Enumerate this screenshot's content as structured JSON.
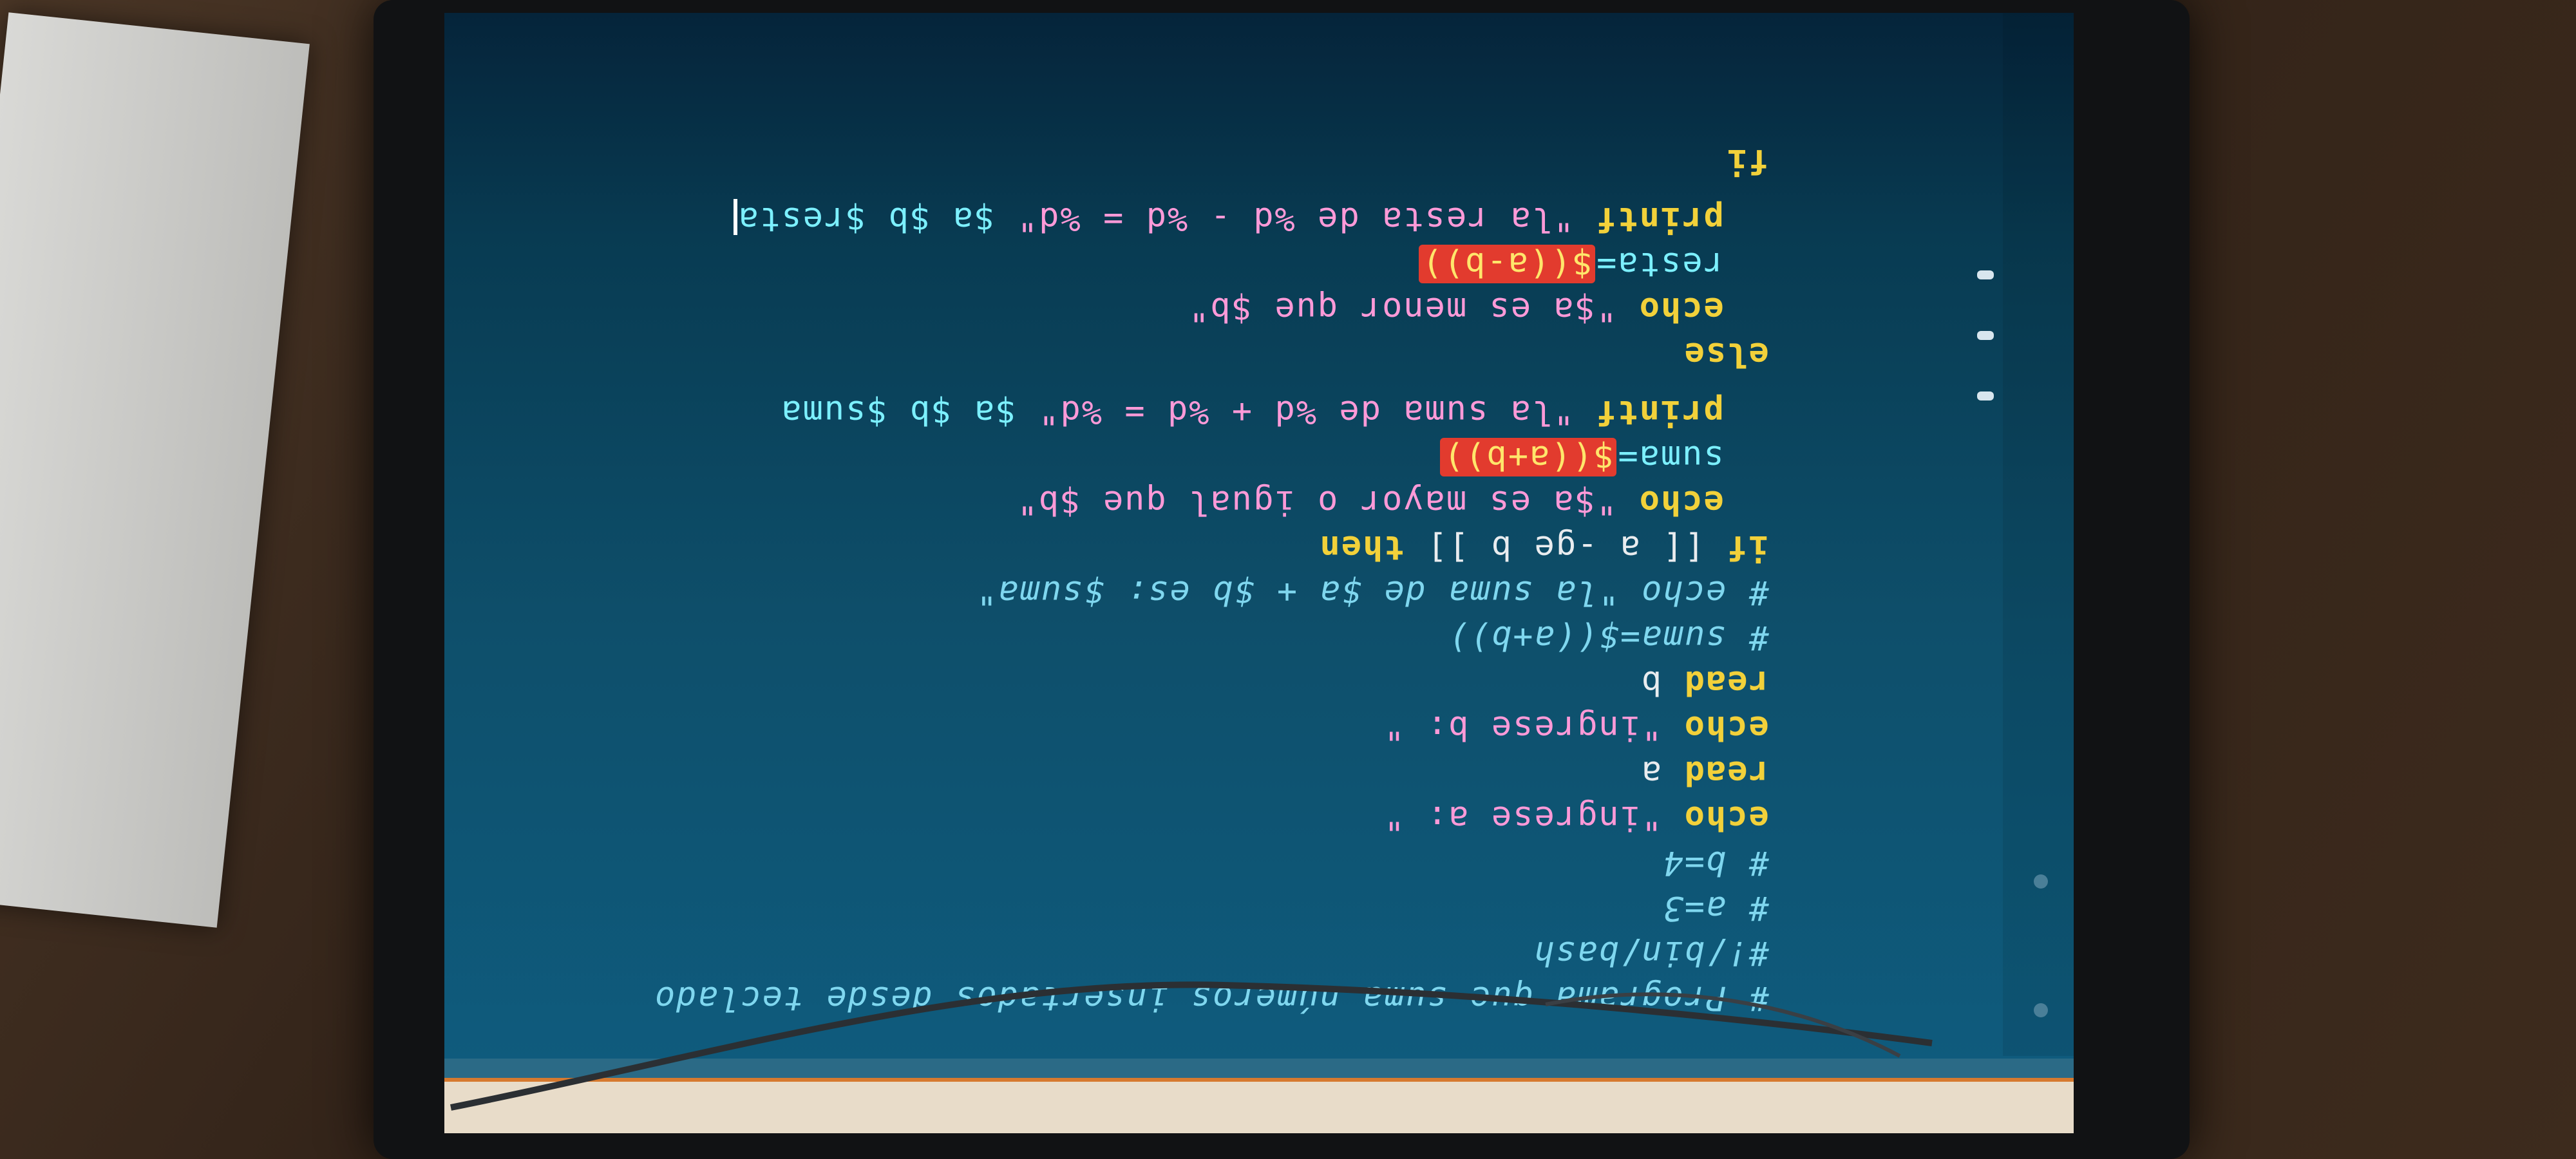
{
  "window": {
    "title": "# Programa que suma números insertados desde teclado"
  },
  "code_lines": [
    {
      "id": "l1",
      "text": "# Programa que suma números insertados desde teclado",
      "kind": "comment"
    },
    {
      "id": "l2",
      "text": "#!/bin/bash",
      "kind": "comment"
    },
    {
      "id": "l3",
      "text": "# a=3",
      "kind": "comment"
    },
    {
      "id": "l4",
      "text": "# b=4",
      "kind": "comment"
    },
    {
      "id": "l5_kw",
      "text": "echo",
      "kind": "kw"
    },
    {
      "id": "l5_str",
      "text": " \"ingrese a: \"",
      "kind": "str"
    },
    {
      "id": "l6_kw",
      "text": "read",
      "kind": "kw"
    },
    {
      "id": "l6_var",
      "text": " a",
      "kind": "plain"
    },
    {
      "id": "l7_kw",
      "text": "echo",
      "kind": "kw"
    },
    {
      "id": "l7_str",
      "text": " \"ingrese b: \"",
      "kind": "str"
    },
    {
      "id": "l8_kw",
      "text": "read",
      "kind": "kw"
    },
    {
      "id": "l8_var",
      "text": " b",
      "kind": "plain"
    },
    {
      "id": "l9",
      "text": "# suma=$((a+b))",
      "kind": "comment"
    },
    {
      "id": "l10",
      "text": "# echo \"la suma de $a + $b es: $suma\"",
      "kind": "comment"
    },
    {
      "id": "l11_kw",
      "text": "if",
      "kind": "kw"
    },
    {
      "id": "l11_rest",
      "text": " [[ a -ge b ]] ",
      "kind": "plain"
    },
    {
      "id": "l11_then",
      "text": "then",
      "kind": "kw"
    },
    {
      "id": "l12_kw",
      "text": "echo",
      "kind": "kw"
    },
    {
      "id": "l12_str",
      "text": " \"$a es mayor o igual que $b\"",
      "kind": "str"
    },
    {
      "id": "l13_var",
      "text": "suma=",
      "kind": "var"
    },
    {
      "id": "l13_hl",
      "text": "$((a+b))",
      "kind": "hl"
    },
    {
      "id": "l14_kw",
      "text": "printf",
      "kind": "kw"
    },
    {
      "id": "l14_str",
      "text": " \"la suma de %d + %d = %d\"",
      "kind": "str"
    },
    {
      "id": "l14_vars",
      "text": " $a $b $suma",
      "kind": "var"
    },
    {
      "id": "l15_kw",
      "text": "else",
      "kind": "kw"
    },
    {
      "id": "l16_kw",
      "text": "echo",
      "kind": "kw"
    },
    {
      "id": "l16_str",
      "text": " \"$a es menor que $b\"",
      "kind": "str"
    },
    {
      "id": "l17_var",
      "text": "resta=",
      "kind": "var"
    },
    {
      "id": "l17_hl",
      "text": "$((a-b))",
      "kind": "hl"
    },
    {
      "id": "l18_kw",
      "text": "printf",
      "kind": "kw"
    },
    {
      "id": "l18_str",
      "text": " \"la resta de %d - %d = %d\"",
      "kind": "str"
    },
    {
      "id": "l18_vars",
      "text": " $a $b $resta",
      "kind": "var"
    },
    {
      "id": "l19_kw",
      "text": "fi",
      "kind": "kw"
    }
  ],
  "colors": {
    "background": "#0e4f6b",
    "comment": "#7fd7ef",
    "keyword": "#f2d13a",
    "string": "#ff9ad8",
    "variable": "#7cf0ff",
    "highlight": "#e23b2e",
    "header": "#e8dcc9",
    "header_accent": "#d77a2f"
  }
}
